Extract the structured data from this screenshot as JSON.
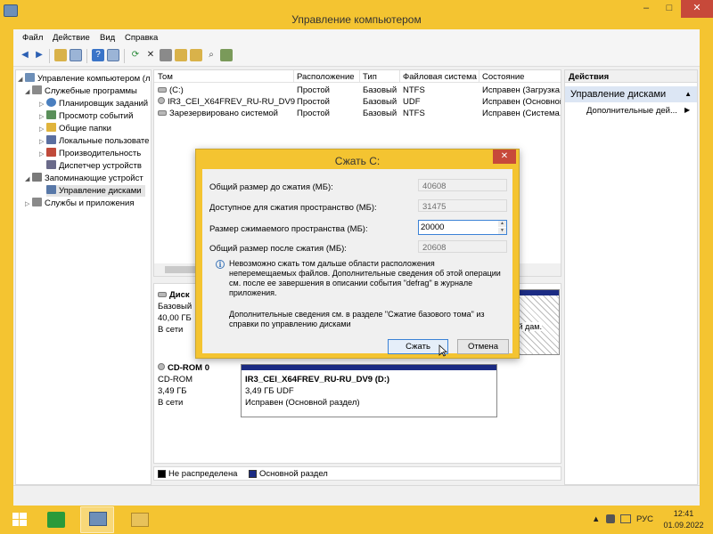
{
  "window": {
    "title": "Управление компьютером",
    "controls": {
      "minimize": "–",
      "maximize": "□",
      "close": "✕"
    }
  },
  "menu": [
    "Файл",
    "Действие",
    "Вид",
    "Справка"
  ],
  "tree": {
    "items": [
      {
        "label": "Управление компьютером (л",
        "icon": "computer-management-icon",
        "color": "#6d8fb8"
      },
      {
        "label": "Служебные программы",
        "icon": "tools-icon",
        "color": "#8a8a8a"
      },
      {
        "label": "Планировщик заданий",
        "icon": "clock-icon",
        "color": "#4a7fbf"
      },
      {
        "label": "Просмотр событий",
        "icon": "event-viewer-icon",
        "color": "#5a8f5a"
      },
      {
        "label": "Общие папки",
        "icon": "shared-folder-icon",
        "color": "#e0b43c"
      },
      {
        "label": "Локальные пользовате",
        "icon": "users-icon",
        "color": "#5b6fa0"
      },
      {
        "label": "Производительность",
        "icon": "performance-icon",
        "color": "#c04a3a"
      },
      {
        "label": "Диспетчер устройств",
        "icon": "device-manager-icon",
        "color": "#6a6a8a"
      },
      {
        "label": "Запоминающие устройст",
        "icon": "storage-icon",
        "color": "#7a7a7a"
      },
      {
        "label": "Управление дисками",
        "icon": "disk-management-icon",
        "color": "#5878a8"
      },
      {
        "label": "Службы и приложения",
        "icon": "services-icon",
        "color": "#8a8a8a"
      }
    ]
  },
  "volumes": {
    "headers": [
      "Том",
      "Расположение",
      "Тип",
      "Файловая система",
      "Состояние"
    ],
    "rows": [
      [
        "(C:)",
        "Простой",
        "Базовый",
        "NTFS",
        "Исправен (Загрузка,"
      ],
      [
        "IR3_CEI_X64FREV_RU-RU_DV9 (D:)",
        "Простой",
        "Базовый",
        "UDF",
        "Исправен (Основной"
      ],
      [
        "Зарезервировано системой",
        "Простой",
        "Базовый",
        "NTFS",
        "Исправен (Система,"
      ]
    ]
  },
  "disks": [
    {
      "name": "Диск",
      "type": "Базовый",
      "size": "40,00 ГБ",
      "status": "В сети",
      "tail_label": "ый дам."
    },
    {
      "name": "CD-ROM 0",
      "type": "CD-ROM",
      "size": "3,49 ГБ",
      "status": "В сети",
      "volume": {
        "name": "IR3_CEI_X64FREV_RU-RU_DV9  (D:)",
        "fs": "3,49 ГБ UDF",
        "status": "Исправен (Основной раздел)"
      }
    }
  ],
  "legend": {
    "items": [
      {
        "label": "Не распределена",
        "color": "#000000"
      },
      {
        "label": "Основной раздел",
        "color": "#1c2c84"
      }
    ]
  },
  "actions": {
    "header": "Действия",
    "selected": "Управление дисками",
    "item": "Дополнительные дей..."
  },
  "dialog": {
    "title": "Сжать C:",
    "fields": [
      {
        "label": "Общий размер до сжатия (МБ):",
        "value": "40608"
      },
      {
        "label": "Доступное для сжатия пространство (МБ):",
        "value": "31475"
      },
      {
        "label": "Размер сжимаемого пространства (МБ):",
        "value": "20000"
      },
      {
        "label": "Общий размер после сжатия (МБ):",
        "value": "20608"
      }
    ],
    "info": "Невозможно сжать том дальше области расположения неперемещаемых файлов. Дополнительные сведения об этой операции см. после ее завершения в описании события \"defrag\" в журнале приложения.",
    "more": "Дополнительные сведения см. в разделе \"Сжатие базового тома\" из справки по управлению дисками",
    "shrink_button": "Сжать",
    "cancel_button": "Отмена"
  },
  "taskbar": {
    "lang": "РУС",
    "time": "12:41",
    "date": "01.09.2022"
  }
}
